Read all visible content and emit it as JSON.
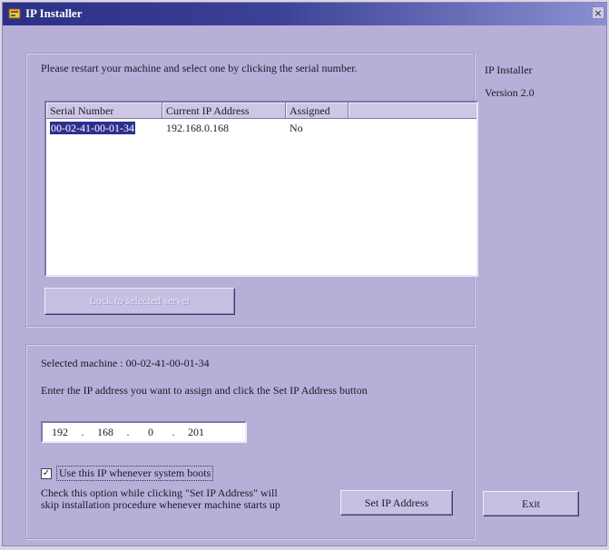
{
  "window": {
    "title": "IP Installer",
    "close_glyph": "×",
    "icon": "app-icon"
  },
  "top_panel": {
    "instruction": "Please restart your machine and select one by clicking the serial number.",
    "columns": [
      "Serial Number",
      "Current IP Address",
      "Assigned",
      ""
    ],
    "rows": [
      {
        "serial": "00-02-41-00-01-34",
        "ip": "192.168.0.168",
        "assigned": "No"
      }
    ],
    "lock_button": "Lock to selected server"
  },
  "bottom_panel": {
    "selected_machine": "Selected machine : 00-02-41-00-01-34",
    "enter_text": "Enter the IP address you want to assign and click the Set IP Address button",
    "ip_octets": [
      "192",
      "168",
      "0",
      "201"
    ],
    "checkbox_checked": true,
    "checkbox_glyph": "✓",
    "checkbox_label": "Use this IP whenever system boots",
    "check_help": "Check this option while clicking \"Set IP Address\" will skip installation procedure whenever machine starts up",
    "set_button": "Set IP Address"
  },
  "side": {
    "product": "IP Installer",
    "version": "Version 2.0"
  },
  "exit_button": "Exit"
}
